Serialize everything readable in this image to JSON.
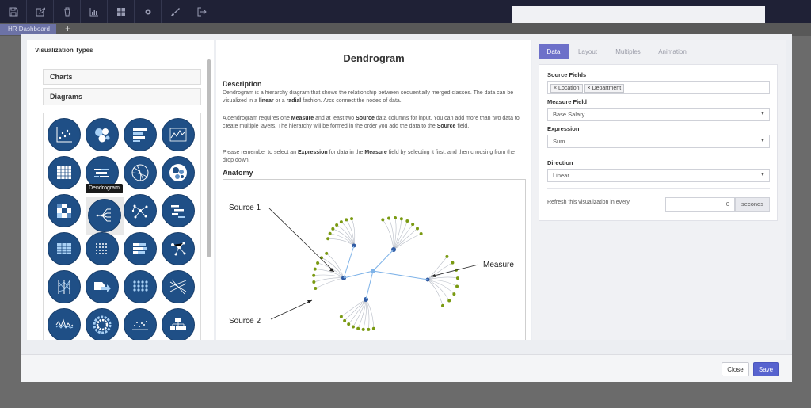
{
  "toolbar": {
    "icons": [
      "save-icon",
      "edit-icon",
      "trash-icon",
      "bar-chart-icon",
      "grid-icon",
      "gear-icon",
      "brush-icon",
      "exit-icon",
      "menu-icon"
    ]
  },
  "tabbar": {
    "tab_label": "HR Dashboard",
    "add_label": "+"
  },
  "left": {
    "title": "Visualization Types",
    "sections": [
      "Charts",
      "Diagrams"
    ],
    "tooltip": "Dendrogram"
  },
  "middle": {
    "title": "Dendrogram",
    "description_heading": "Description",
    "desc1": {
      "a": "Dendrogram is a hierarchy diagram that shows the relationship between sequentially merged classes. The data can be visualized in a ",
      "linear": "linear",
      "b": " or a ",
      "radial": "radial",
      "c": " fashion. Arcs connect the nodes of data."
    },
    "desc2": {
      "a": "A dendrogram requires one ",
      "measure": "Measure",
      "b": " and at least two ",
      "source": "Source",
      "c": " data columns for input. You can add more than two data to create multiple layers. The hierarchy will be formed in the order you add the data to the ",
      "source2": "Source",
      "d": " field."
    },
    "desc3": {
      "a": "Please remember to select an ",
      "expression": "Expression",
      "b": " for data in the ",
      "measure": "Measure",
      "c": " field by selecting it first, and then choosing from the drop down."
    },
    "anatomy_heading": "Anatomy",
    "anatomy_labels": {
      "source1": "Source 1",
      "source2": "Source 2",
      "measure": "Measure"
    }
  },
  "right": {
    "tabs": [
      "Data",
      "Layout",
      "Multiples",
      "Animation"
    ],
    "source_fields_label": "Source Fields",
    "source_chips": [
      "Location",
      "Department"
    ],
    "measure_field_label": "Measure Field",
    "measure_value": "Base Salary",
    "expression_label": "Expression",
    "expression_value": "Sum",
    "direction_label": "Direction",
    "direction_value": "Linear",
    "refresh_label": "Refresh this visualization in every",
    "refresh_value": "0",
    "refresh_unit": "seconds"
  },
  "footer": {
    "close_label": "Close",
    "save_label": "Save"
  },
  "colors": {
    "toolbar": "#1f2136",
    "accent": "#5763cf",
    "tile": "#1f4f86",
    "leaf_node": "#7a9a12",
    "branch_node": "#2f5aa3"
  }
}
